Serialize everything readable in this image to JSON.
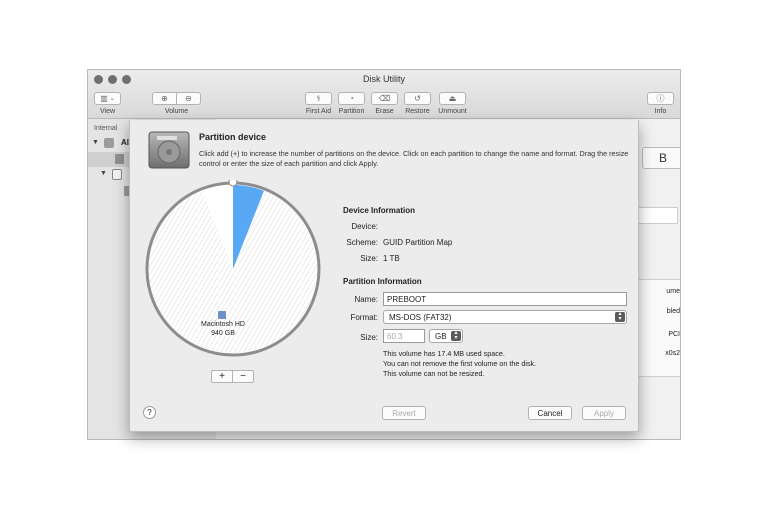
{
  "window": {
    "title": "Disk Utility"
  },
  "toolbar": {
    "view_label": "View",
    "volume_label": "Volume",
    "first_aid_label": "First Aid",
    "partition_label": "Partition",
    "erase_label": "Erase",
    "restore_label": "Restore",
    "unmount_label": "Unmount",
    "info_label": "Info"
  },
  "sidebar": {
    "section_label": "Internal",
    "item_partial": "Al"
  },
  "background_fragments": {
    "b": "B",
    "ume": "ume",
    "bled": "bled",
    "pci": "PCI",
    "x0s2": "x0s2"
  },
  "sheet": {
    "title": "Partition device",
    "description": "Click add (+) to increase the number of partitions on the device. Click on each partition to change the name and format. Drag the resize control or enter the size of each partition and click Apply.",
    "pie": {
      "partition_name": "Macintosh HD",
      "partition_size": "940 GB",
      "selected_fraction": 0.06,
      "add_symbol": "+",
      "remove_symbol": "−"
    },
    "device_info": {
      "heading": "Device Information",
      "device_label": "Device:",
      "device_value": "",
      "scheme_label": "Scheme:",
      "scheme_value": "GUID Partition Map",
      "size_label": "Size:",
      "size_value": "1 TB"
    },
    "partition_info": {
      "heading": "Partition Information",
      "name_label": "Name:",
      "name_value": "PREBOOT",
      "format_label": "Format:",
      "format_value": "MS-DOS (FAT32)",
      "size_label": "Size:",
      "size_value": "60.3",
      "size_unit": "GB",
      "note1": "This volume has 17.4 MB used space.",
      "note2": "You can not remove the first volume on the disk.",
      "note3": "This volume can not be resized."
    },
    "buttons": {
      "help": "?",
      "revert": "Revert",
      "cancel": "Cancel",
      "apply": "Apply"
    }
  }
}
